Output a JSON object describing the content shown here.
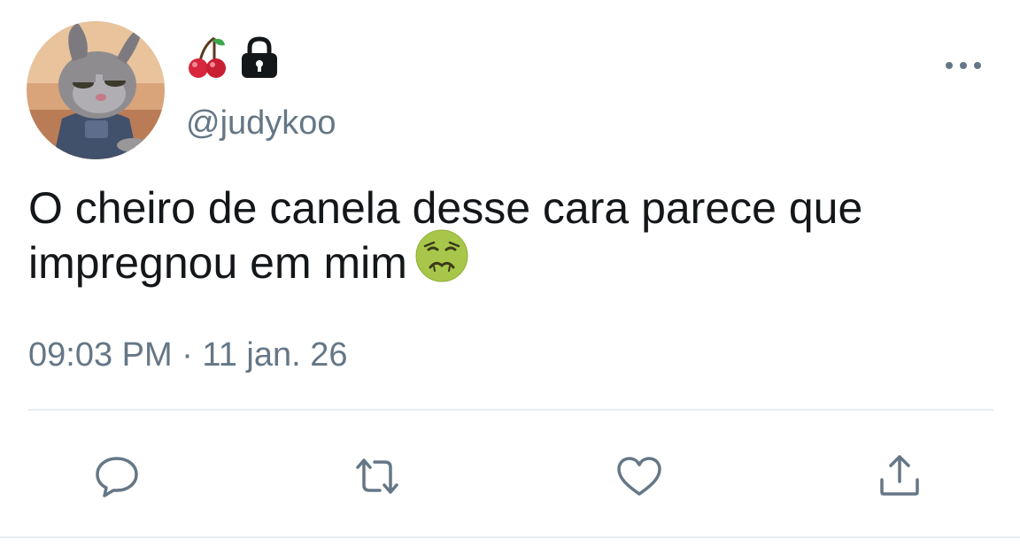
{
  "tweet": {
    "name_icons": [
      "cherries-icon",
      "lock-icon"
    ],
    "handle": "@judykoo",
    "text_line1": "O cheiro de canela desse cara parece que",
    "text_line2": "impregnou em mim",
    "text_emoji": "nauseated-face-icon",
    "timestamp": "09:03 PM · 11 jan. 26"
  },
  "actions": [
    "reply-icon",
    "retweet-icon",
    "like-icon",
    "share-icon"
  ],
  "colors": {
    "text": "#14171a",
    "secondary": "#657786",
    "divider": "#e6ecf0",
    "background": "#ffffff"
  }
}
